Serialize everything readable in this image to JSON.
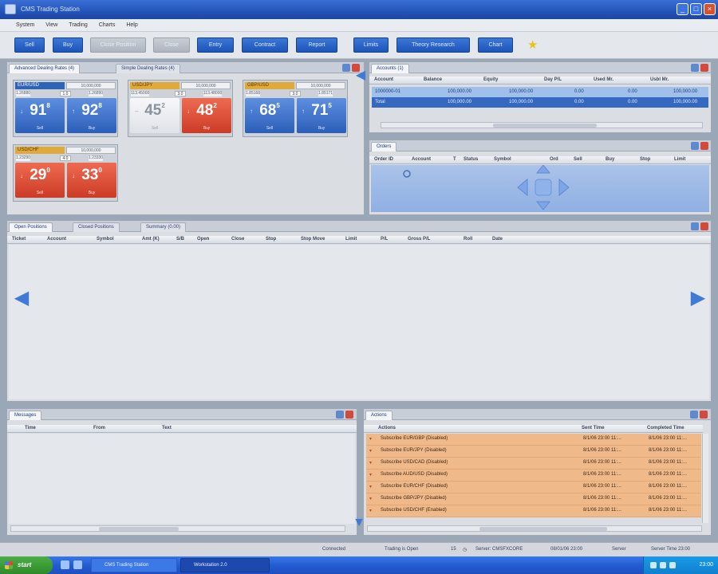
{
  "window": {
    "title": "CMS Trading Station"
  },
  "menu": [
    "System",
    "View",
    "Trading",
    "Charts",
    "Help"
  ],
  "toolbar": {
    "buttons": [
      "Sell",
      "Buy",
      "Close Position",
      "Close",
      "Entry",
      "Contract",
      "Report",
      "Limits",
      "Theory Research",
      "Chart"
    ]
  },
  "rates_panel": {
    "tabs": [
      "Advanced Dealing Rates (4)",
      "Simple Dealing Rates (4)"
    ],
    "tiles": [
      {
        "pair": "EUR/USD",
        "lots": "10,000,000",
        "left": "1.26880",
        "spread": "1.0",
        "right": "1.26890",
        "sell_value": "91",
        "sell_pip": "8",
        "buy_value": "92",
        "buy_pip": "8",
        "sell_label": "Sell",
        "buy_label": "Buy"
      },
      {
        "pair": "USD/JPY",
        "lots": "10,000,000",
        "left": "113.45000",
        "spread": "3.0",
        "right": "113.48000",
        "sell_value": "45",
        "sell_pip": "2",
        "buy_value": "48",
        "buy_pip": "2",
        "sell_label": "Sell",
        "buy_label": "Buy"
      },
      {
        "pair": "GBP/USD",
        "lots": "10,000,000",
        "left": "1.85168",
        "spread": "3.0",
        "right": "1.85171",
        "sell_value": "68",
        "sell_pip": "5",
        "buy_value": "71",
        "buy_pip": "5",
        "sell_label": "Sell",
        "buy_label": "Buy"
      },
      {
        "pair": "USD/CHF",
        "lots": "10,000,000",
        "left": "1.23290",
        "spread": "4.0",
        "right": "1.23330",
        "sell_value": "29",
        "sell_pip": "0",
        "buy_value": "33",
        "buy_pip": "0",
        "sell_label": "Sell",
        "buy_label": "Buy"
      }
    ]
  },
  "accounts_panel": {
    "tab": "Accounts (1)",
    "columns": [
      "Account",
      "Balance",
      "Equity",
      "Day P/L",
      "Used Mr.",
      "Usbl Mr."
    ],
    "rows": [
      [
        "1000000-01",
        "100,000.00",
        "100,000.00",
        "0.00",
        "0.00",
        "100,000.00"
      ],
      [
        "Total",
        "100,000.00",
        "100,000.00",
        "0.00",
        "0.00",
        "100,000.00"
      ]
    ]
  },
  "orders_panel": {
    "tab": "Orders",
    "columns": [
      "Order ID",
      "Account",
      "T",
      "Status",
      "Symbol",
      "Ord",
      "Sell",
      "Buy",
      "Stop",
      "Limit"
    ]
  },
  "positions_panel": {
    "tabs": [
      "Open Positions",
      "Closed Positions",
      "Summary (0.00)"
    ],
    "columns": [
      "Ticket",
      "Account",
      "Symbol",
      "Amt (K)",
      "S/B",
      "Open",
      "Close",
      "Stop",
      "Stop Move",
      "Limit",
      "P/L",
      "Gross P/L",
      "Roll",
      "Date"
    ]
  },
  "messages_panel": {
    "tab": "Messages",
    "columns": [
      "Time",
      "From",
      "Text"
    ]
  },
  "actions_panel": {
    "tab": "Actions",
    "columns": [
      "Actions",
      "Sent Time",
      "Completed Time"
    ],
    "rows": [
      [
        "Subscribe EUR/GBP (Disabled)",
        "8/1/06 23:00 11:...",
        "8/1/06 23:00 11:..."
      ],
      [
        "Subscribe EUR/JPY (Disabled)",
        "8/1/06 23:00 11:...",
        "8/1/06 23:00 11:..."
      ],
      [
        "Subscribe USD/CAD (Disabled)",
        "8/1/06 23:00 11:...",
        "8/1/06 23:00 11:..."
      ],
      [
        "Subscribe AUD/USD (Disabled)",
        "8/1/06 23:00 11:...",
        "8/1/06 23:00 11:..."
      ],
      [
        "Subscribe EUR/CHF (Disabled)",
        "8/1/06 23:00 11:...",
        "8/1/06 23:00 11:..."
      ],
      [
        "Subscribe GBP/JPY (Disabled)",
        "8/1/06 23:00 11:...",
        "8/1/06 23:00 11:..."
      ],
      [
        "Subscribe USD/CHF (Enabled)",
        "8/1/06 23:00 11:...",
        "8/1/06 23:00 11:..."
      ]
    ]
  },
  "status": {
    "connection": "Connected",
    "trading": "Trading is Open",
    "count": "15",
    "server": "Server: CMSFXCORE",
    "date": "08/01/06 23:00",
    "label": "Server",
    "time": "Server Time 23:00"
  },
  "taskbar": {
    "start": "start",
    "items": [
      "CMS Trading Station",
      "Workstation 2.0"
    ],
    "clock": "23:00"
  }
}
